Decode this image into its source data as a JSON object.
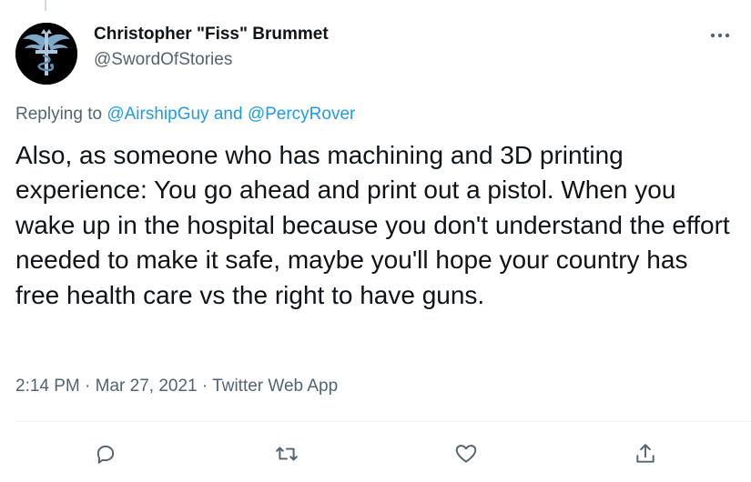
{
  "author": {
    "name": "Christopher \"Fiss\" Brummet",
    "handle": "@SwordOfStories",
    "avatar_icon": "flamel-cross-avatar"
  },
  "more_icon": "ellipsis-icon",
  "reply": {
    "prefix": "Replying to",
    "mention_1": "@AirshipGuy",
    "conjunction": "and",
    "mention_2": "@PercyRover"
  },
  "tweet_text": "Also, as someone who has machining and 3D printing experience:  You go ahead and print out a pistol.  When you wake up in the hospital because you don't understand the effort needed to make it safe, maybe you'll hope your country has free health care vs the right to have guns.",
  "meta": {
    "time": "2:14 PM",
    "separator_1": "·",
    "date": "Mar 27, 2021",
    "separator_2": "·",
    "source": "Twitter Web App"
  },
  "actions": [
    {
      "name": "reply",
      "icon": "reply-icon"
    },
    {
      "name": "retweet",
      "icon": "retweet-icon"
    },
    {
      "name": "like",
      "icon": "heart-icon"
    },
    {
      "name": "share",
      "icon": "share-icon"
    }
  ],
  "colors": {
    "text": "#0f1419",
    "secondary": "#536471",
    "link": "#1d9bf0",
    "divider": "#eff3f4"
  }
}
